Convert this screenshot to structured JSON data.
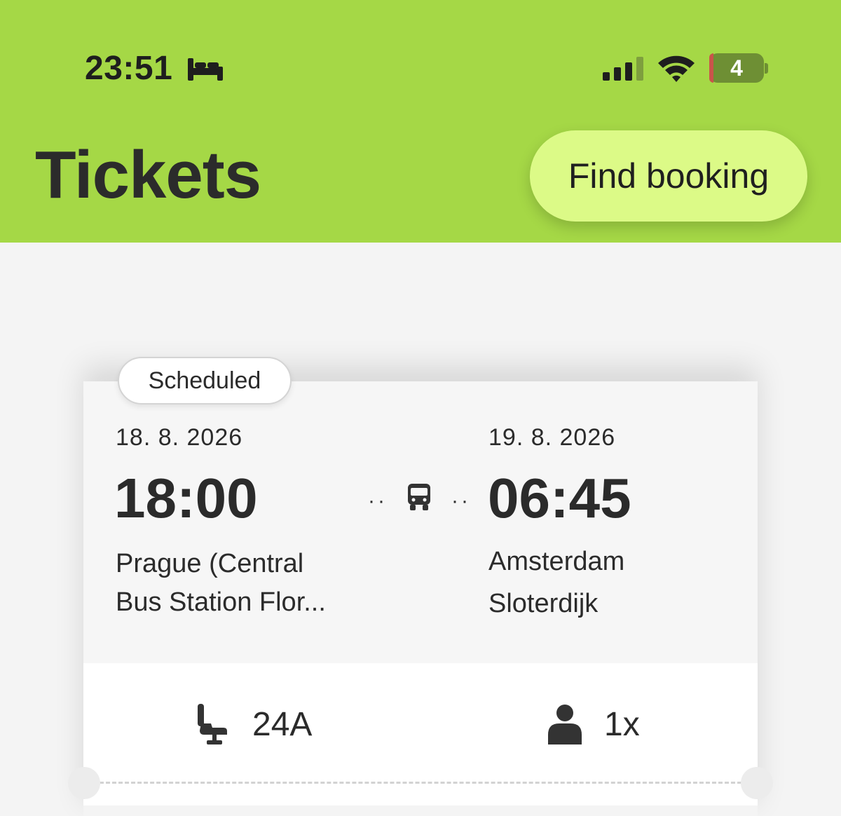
{
  "status_bar": {
    "time": "23:51",
    "focus_icon": "bed-icon",
    "battery_level": "4",
    "colors": {
      "battery": "#6e8f34",
      "battery_low_edge": "#c9544a"
    }
  },
  "header": {
    "title": "Tickets",
    "find_booking_label": "Find booking",
    "colors": {
      "background": "#a5d846",
      "button": "#dcfa87"
    }
  },
  "ticket": {
    "status": "Scheduled",
    "departure": {
      "date": "18. 8. 2026",
      "time": "18:00",
      "place_line1": "Prague (Central",
      "place_line2": "Bus Station Flor..."
    },
    "transport_icon": "bus-icon",
    "arrival": {
      "date": "19. 8. 2026",
      "time": "06:45",
      "place_line1": "Amsterdam",
      "place_line2": "Sloterdijk"
    },
    "seat": {
      "icon": "seat-icon",
      "value": "24A"
    },
    "passengers": {
      "icon": "person-icon",
      "value": "1x"
    }
  }
}
